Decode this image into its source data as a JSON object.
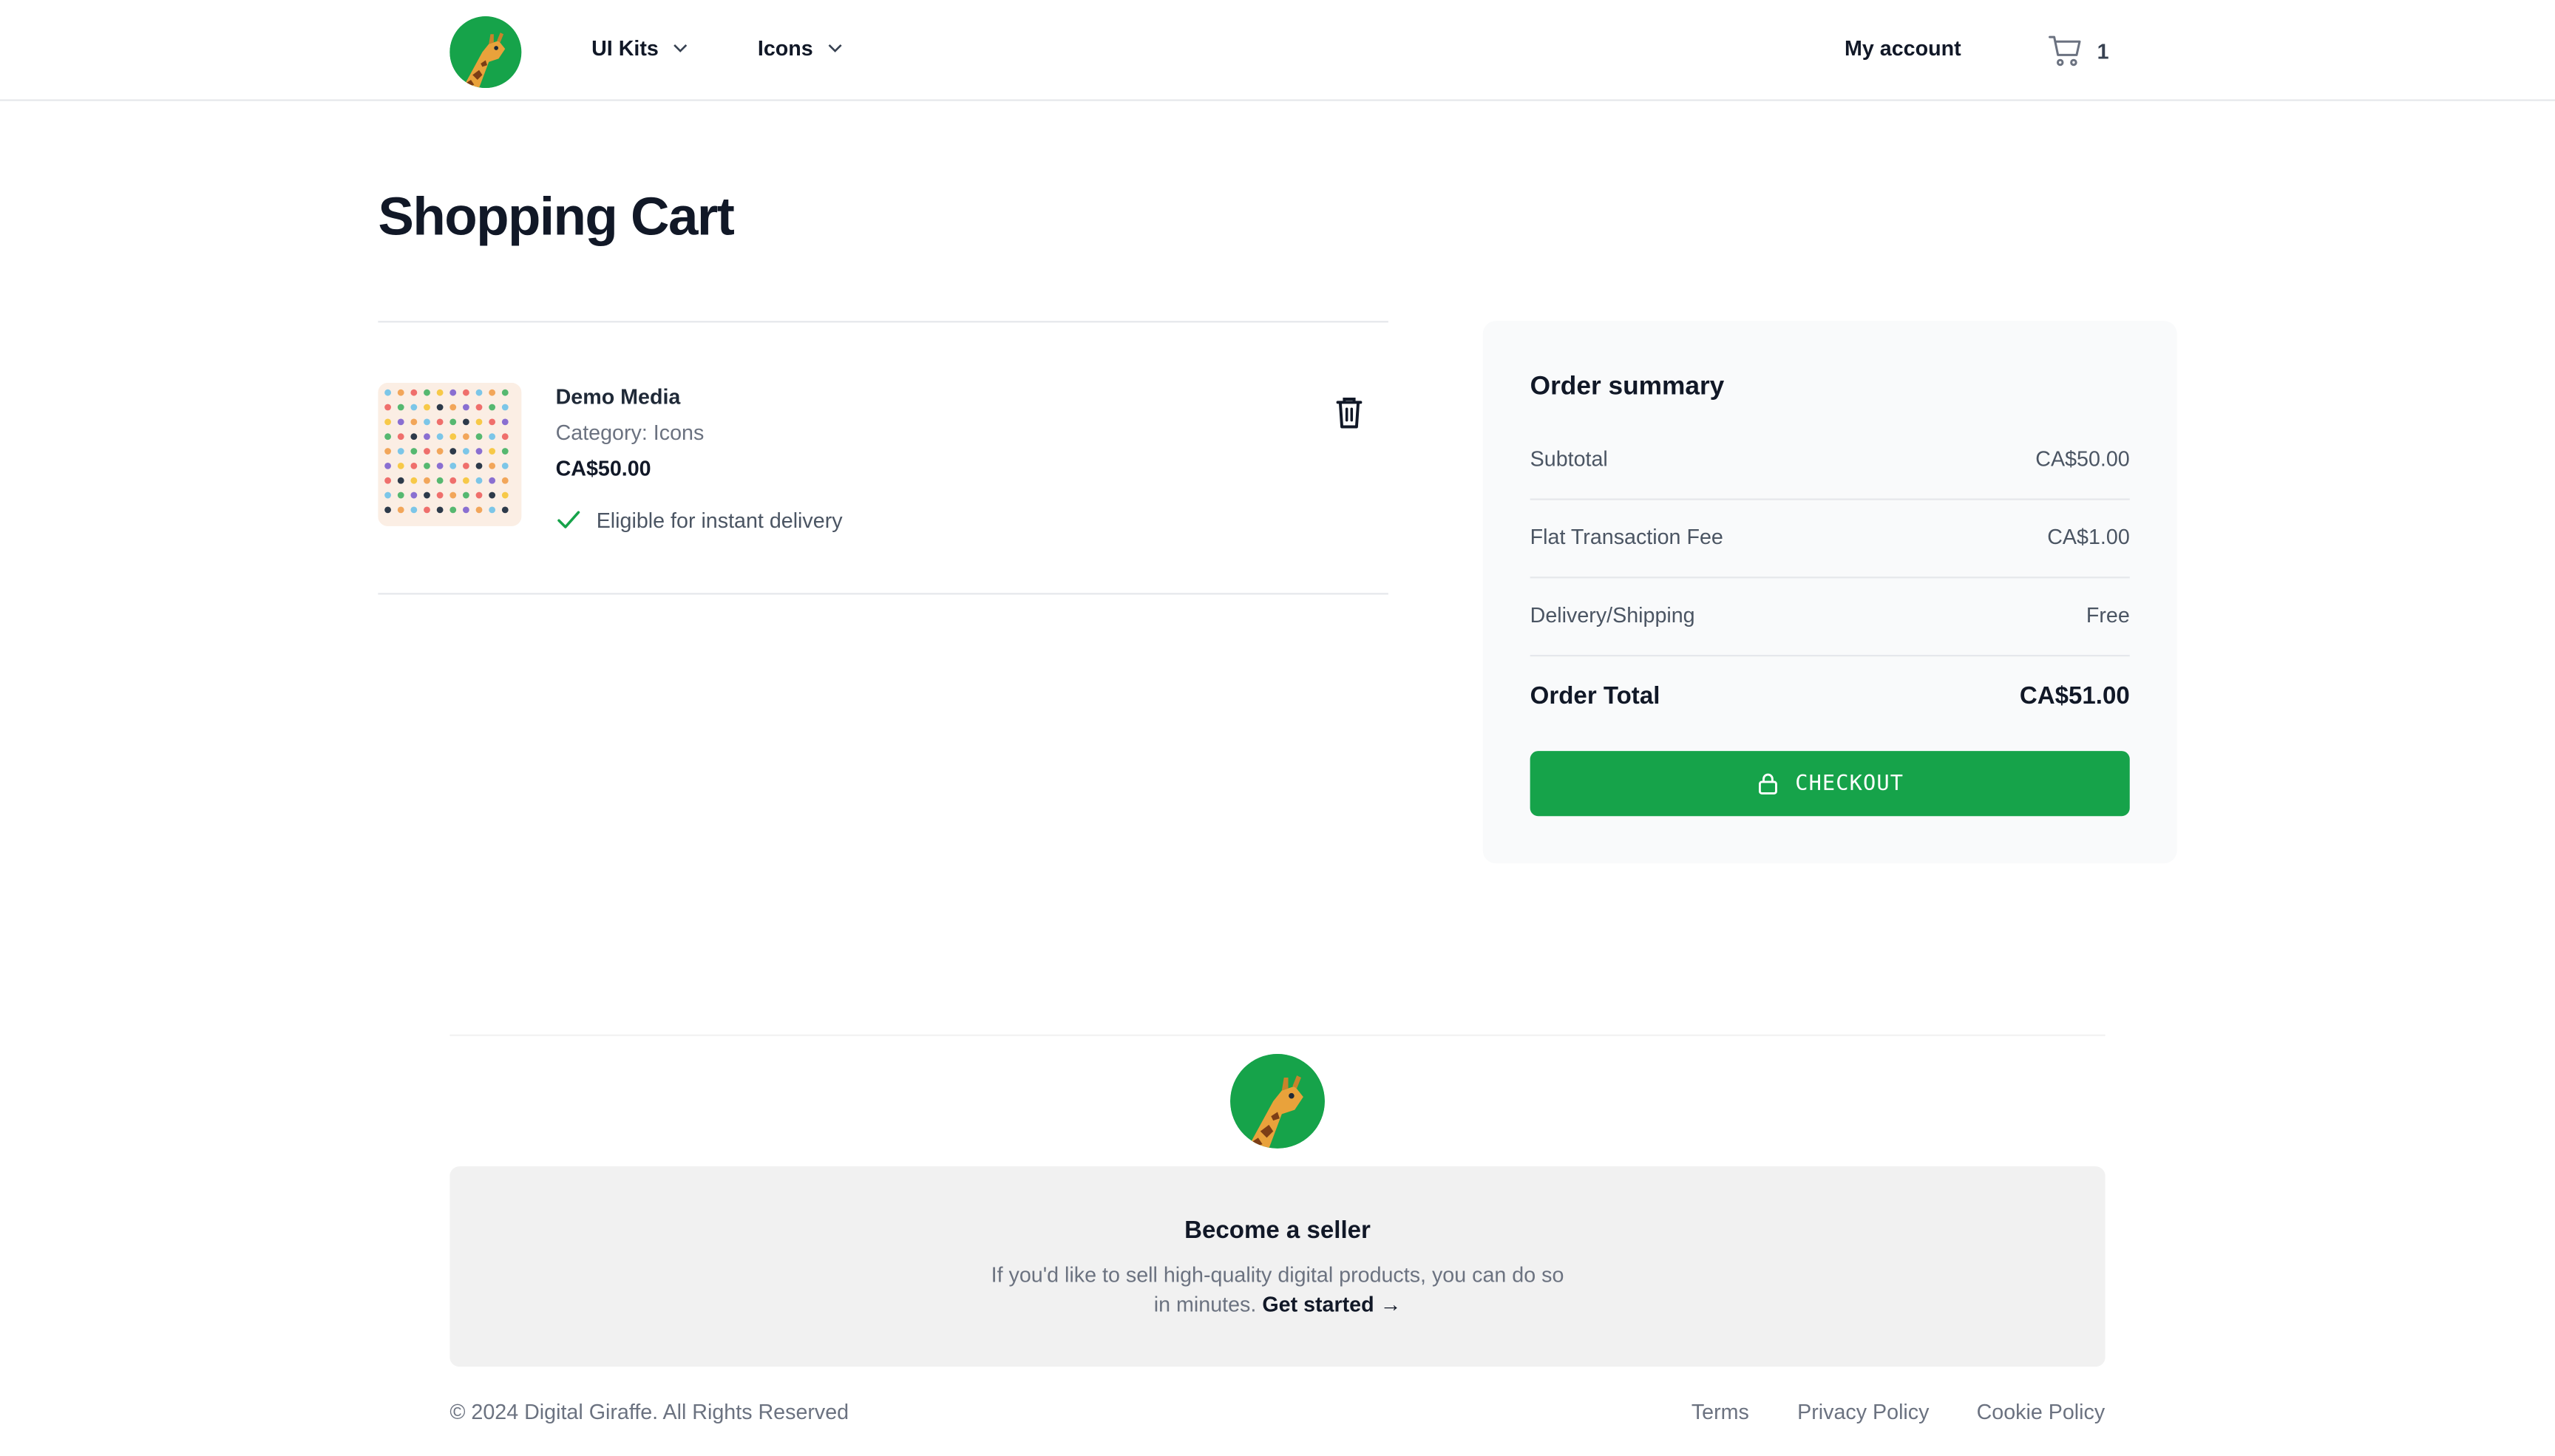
{
  "header": {
    "nav": [
      {
        "label": "UI Kits"
      },
      {
        "label": "Icons"
      }
    ],
    "account_label": "My account",
    "cart_count": "1"
  },
  "page_title": "Shopping Cart",
  "cart": {
    "items": [
      {
        "name": "Demo Media",
        "category": "Category: Icons",
        "price": "CA$50.00",
        "delivery": "Eligible for instant delivery"
      }
    ]
  },
  "summary": {
    "title": "Order summary",
    "rows": [
      {
        "label": "Subtotal",
        "value": "CA$50.00"
      },
      {
        "label": "Flat Transaction Fee",
        "value": "CA$1.00"
      },
      {
        "label": "Delivery/Shipping",
        "value": "Free"
      }
    ],
    "total_label": "Order Total",
    "total_value": "CA$51.00",
    "checkout_label": "CHECKOUT"
  },
  "footer": {
    "seller_title": "Become a seller",
    "seller_text": "If you'd like to sell high-quality digital products, you can do so in minutes.",
    "seller_link": "Get started →",
    "copyright": "© 2024 Digital Giraffe. All Rights Reserved",
    "links": [
      "Terms",
      "Privacy Policy",
      "Cookie Policy"
    ]
  },
  "colors": {
    "brand_green": "#16a34a",
    "text_dark": "#111827",
    "text_muted": "#6b7280"
  }
}
